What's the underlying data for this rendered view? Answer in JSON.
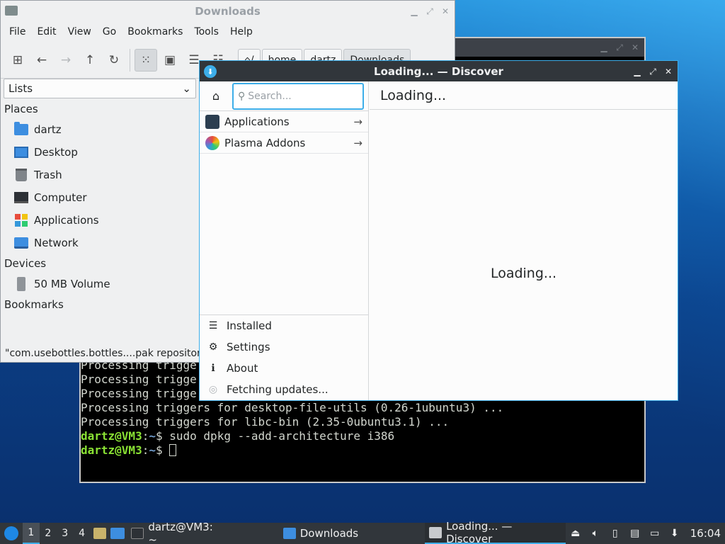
{
  "terminal": {
    "lines": [
      "Processing triggers for desktop-file-utils (0.26-1ubuntu3) ...",
      "Processing triggers for libc-bin (2.35-0ubuntu3.1) ..."
    ],
    "partial_lines": [
      "Processing trigge",
      "Processing trigge",
      "Processing trigge"
    ],
    "prompt_user": "dartz@VM3",
    "prompt_sep": ":",
    "prompt_path": "~",
    "prompt_symbol": "$",
    "command": " sudo dpkg --add-architecture i386"
  },
  "file_manager": {
    "title": "Downloads",
    "menu": [
      "File",
      "Edit",
      "View",
      "Go",
      "Bookmarks",
      "Tools",
      "Help"
    ],
    "breadcrumbs": [
      "/",
      "home",
      "dartz",
      "Downloads"
    ],
    "side_select": "Lists",
    "sections": {
      "places": "Places",
      "devices": "Devices",
      "bookmarks": "Bookmarks"
    },
    "places": [
      "dartz",
      "Desktop",
      "Trash",
      "Computer",
      "Applications",
      "Network"
    ],
    "devices": [
      "50 MB Volume"
    ],
    "status": "\"com.usebottles.bottles....pak repositor"
  },
  "discover": {
    "title": "Loading... — Discover",
    "search_placeholder": "Search...",
    "categories": [
      "Applications",
      "Plasma Addons"
    ],
    "bottom_nav": [
      "Installed",
      "Settings",
      "About",
      "Fetching updates..."
    ],
    "page_header": "Loading...",
    "center_text": "Loading..."
  },
  "taskbar": {
    "workspaces": [
      "1",
      "2",
      "3",
      "4"
    ],
    "tasks": [
      "dartz@VM3: ~",
      "Downloads",
      "Loading... — Discover"
    ],
    "clock": "16:04"
  },
  "colors": {
    "accent": "#3daee9",
    "dark_panel": "#31363b",
    "terminal_green": "#8ae234",
    "terminal_blue": "#729fcf"
  }
}
